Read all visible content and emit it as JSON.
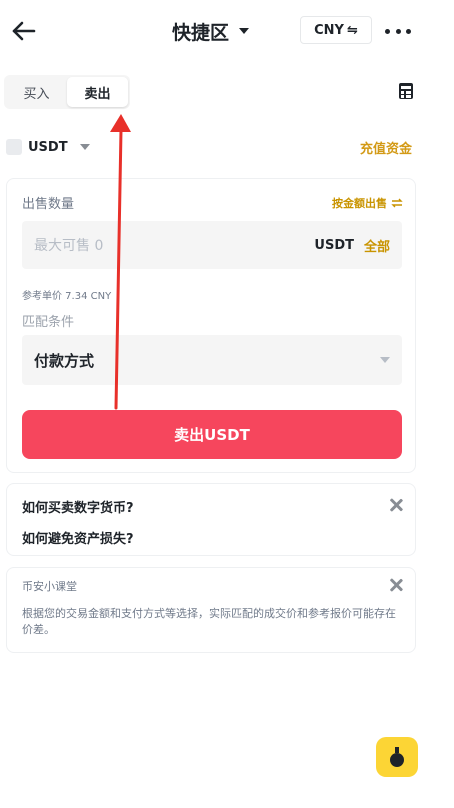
{
  "header": {
    "title": "快捷区",
    "currency": "CNY",
    "currency_switch_glyph": "⇋"
  },
  "tabs": [
    {
      "label": "买入",
      "active": false
    },
    {
      "label": "卖出",
      "active": true
    }
  ],
  "asset": {
    "name": "USDT",
    "recharge_link": "充值资金"
  },
  "sell_form": {
    "quantity_label": "出售数量",
    "by_amount_label": "按金额出售",
    "amount_placeholder": "最大可售 0",
    "unit": "USDT",
    "all_label": "全部",
    "reference_price": "参考单价 7.34 CNY",
    "match_label": "匹配条件",
    "payment_method": "付款方式",
    "submit_label": "卖出USDT"
  },
  "faq": {
    "items": [
      "如何买卖数字货币?",
      "如何避免资产损失?"
    ]
  },
  "tips": {
    "title": "币安小课堂",
    "body": "根据您的交易金额和支付方式等选择，实际匹配的成交价和参考报价可能存在价差。"
  },
  "colors": {
    "accent": "#F0B90B",
    "gold_text": "#C99400",
    "sell_red": "#F6465D",
    "annotation_arrow": "#E8302A"
  },
  "icons": [
    "back-arrow-icon",
    "caret-down-icon",
    "swap-icon",
    "more-dots-icon",
    "calculator-icon",
    "close-icon",
    "reward-icon",
    "annotation-arrow"
  ]
}
